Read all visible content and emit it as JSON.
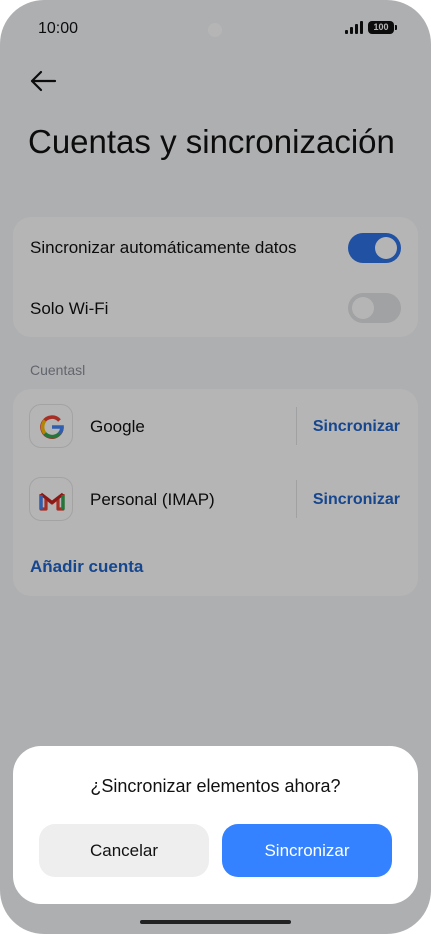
{
  "status_bar": {
    "time": "10:00",
    "battery": "100"
  },
  "header": {
    "title": "Cuentas y sincronización",
    "back_icon": "back-arrow-icon"
  },
  "settings": {
    "auto_sync": {
      "label": "Sincronizar automáticamente datos",
      "enabled": true
    },
    "wifi_only": {
      "label": "Solo Wi-Fi",
      "enabled": false
    }
  },
  "accounts": {
    "section_title": "Cuentasl",
    "items": [
      {
        "name": "Google",
        "icon": "google-icon",
        "action": "Sincronizar"
      },
      {
        "name": "Personal (IMAP)",
        "icon": "gmail-icon",
        "action": "Sincronizar"
      }
    ],
    "add_label": "Añadir cuenta"
  },
  "dialog": {
    "title": "¿Sincronizar elementos ahora?",
    "cancel_label": "Cancelar",
    "confirm_label": "Sincronizar"
  },
  "colors": {
    "accent": "#2f73e6",
    "link": "#1f63c8",
    "primary_button": "#3482ff"
  }
}
